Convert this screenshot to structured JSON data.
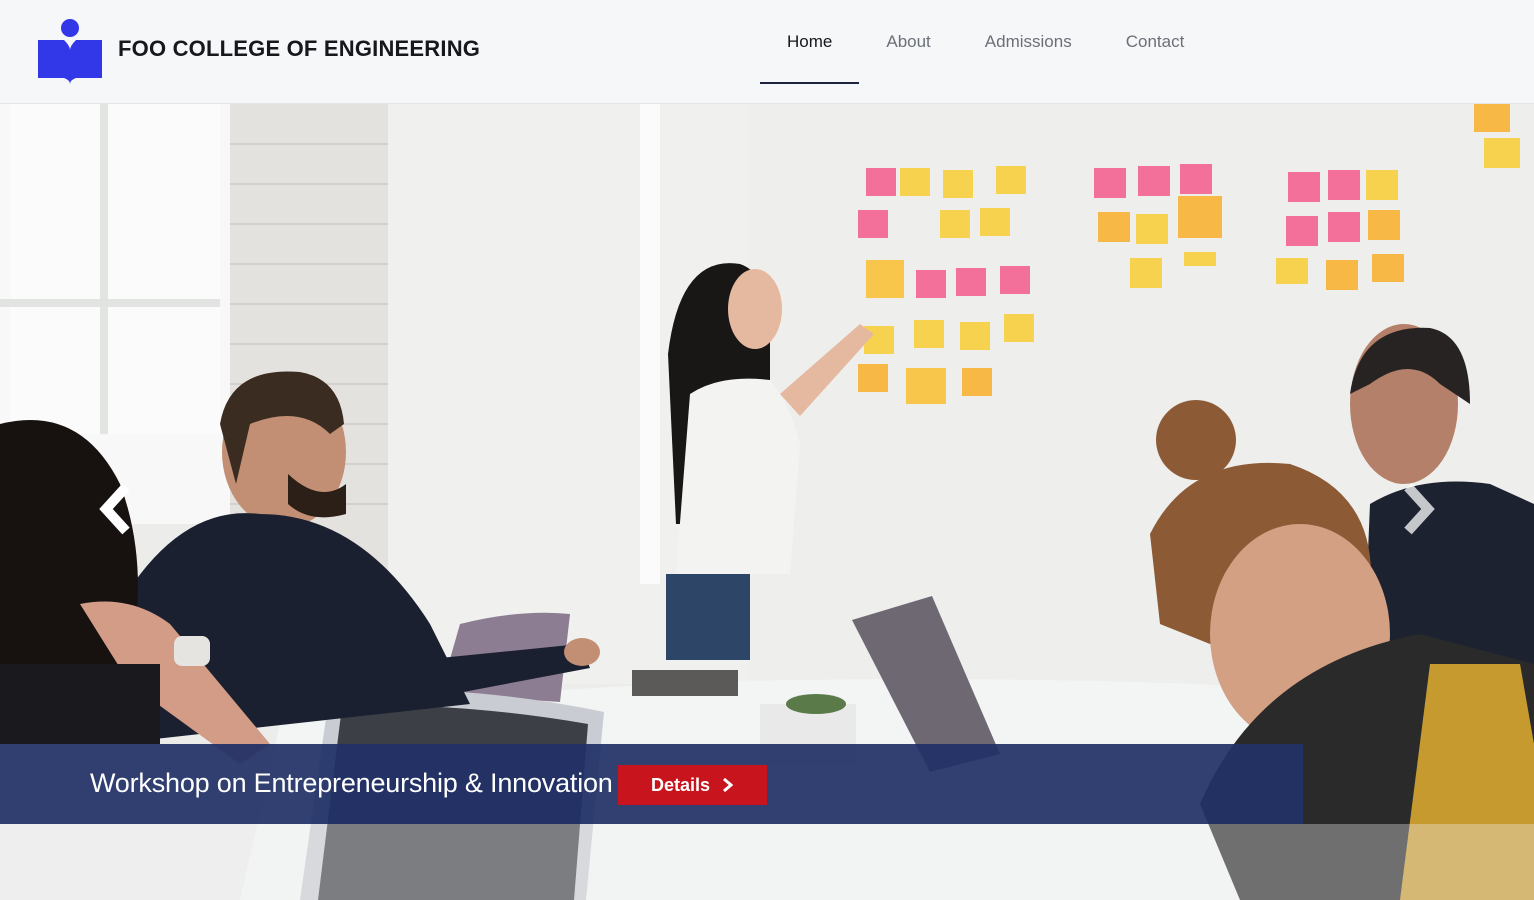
{
  "header": {
    "title": "FOO COLLEGE OF ENGINEERING",
    "logo_icon": "book-reader-icon",
    "brand_color": "#3237e8"
  },
  "nav": {
    "items": [
      {
        "label": "Home",
        "active": true
      },
      {
        "label": "About",
        "active": false
      },
      {
        "label": "Admissions",
        "active": false
      },
      {
        "label": "Contact",
        "active": false
      }
    ]
  },
  "carousel": {
    "prev_icon": "chevron-left-icon",
    "next_icon": "chevron-right-icon",
    "slide": {
      "image_description": "Students in a classroom watching a woman point at sticky notes on a whiteboard",
      "caption": "Workshop on Entrepreneurship & Innovation",
      "button_label": "Details",
      "button_icon": "chevron-right-icon",
      "caption_color": "#213066",
      "button_color": "#c8141c"
    }
  }
}
